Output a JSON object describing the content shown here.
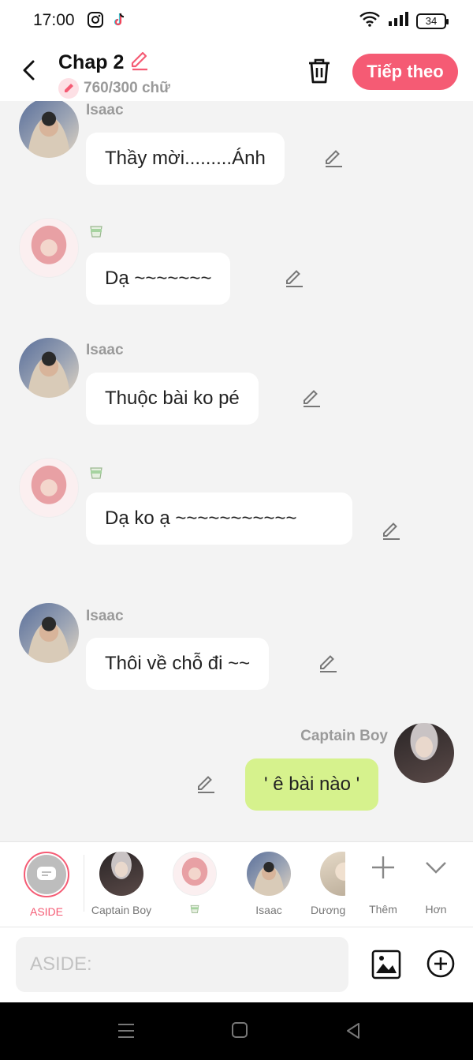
{
  "status_bar": {
    "time": "17:00",
    "battery": "34"
  },
  "header": {
    "title": "Chap 2",
    "count": "760/300 chữ",
    "next_label": "Tiếp theo"
  },
  "messages": [
    {
      "sender": "Isaac",
      "text": "Thầy mời.........Ánh",
      "side": "left",
      "avatar": "isaac"
    },
    {
      "sender": "",
      "text": "Dạ ~~~~~~~",
      "side": "left",
      "avatar": "girl"
    },
    {
      "sender": "Isaac",
      "text": "Thuộc bài ko pé",
      "side": "left",
      "avatar": "isaac"
    },
    {
      "sender": "",
      "text": "Dạ ko ạ ~~~~~~~~~~~",
      "side": "left",
      "avatar": "girl"
    },
    {
      "sender": "Isaac",
      "text": "Thôi về chỗ đi ~~",
      "side": "left",
      "avatar": "isaac"
    },
    {
      "sender": "Captain Boy",
      "text": "' ê bài nào '",
      "side": "right",
      "avatar": "captain"
    }
  ],
  "characters": [
    {
      "label": "ASIDE",
      "selected": true
    },
    {
      "label": "Captain Boy"
    },
    {
      "label": ""
    },
    {
      "label": "Isaac"
    },
    {
      "label": "Dương"
    }
  ],
  "more_label": "Thêm",
  "hon_label": "Hơn",
  "input": {
    "placeholder": "ASIDE:",
    "value": ""
  },
  "colors": {
    "accent": "#f55b74",
    "my_bubble": "#d6f28d",
    "background": "#f3f3f3"
  }
}
